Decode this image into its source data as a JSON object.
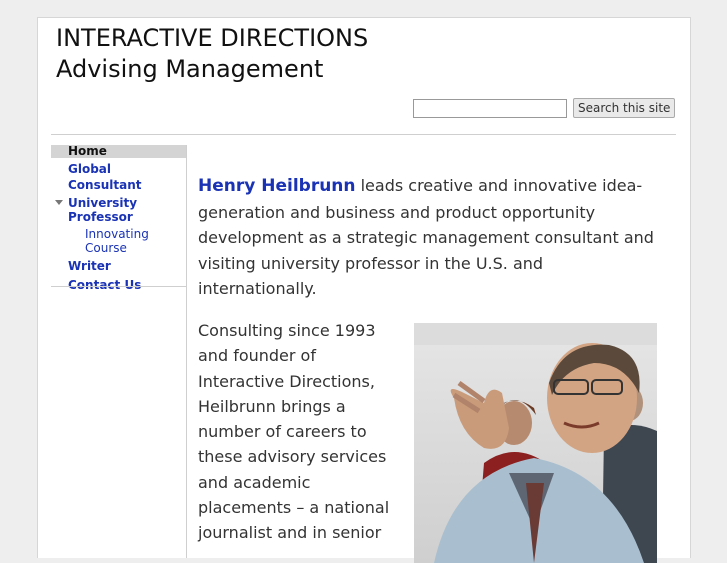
{
  "site": {
    "title": "INTERACTIVE DIRECTIONS Advising Management"
  },
  "search": {
    "value": "",
    "button_label": "Search this site"
  },
  "nav": {
    "home": "Home",
    "global_consultant": "Global Consultant",
    "university_professor": "University Professor",
    "innovating_course": "Innovating Course",
    "writer": "Writer",
    "contact_us": "Contact Us"
  },
  "content": {
    "intro_name": "Henry Heilbrunn",
    "intro_text": " leads creative and innovative idea-generation and business and product opportunity development as a strategic management consultant and visiting university professor in the U.S. and internationally.",
    "paragraph2": "Consulting since 1993 and founder of Interactive Directions, Heilbrunn brings a number of careers to these advisory services and academic placements – a national journalist and in senior"
  },
  "colors": {
    "link": "#1a33b5",
    "nav_active_bg": "#d4d4d4",
    "page_bg": "#eeeeee"
  }
}
